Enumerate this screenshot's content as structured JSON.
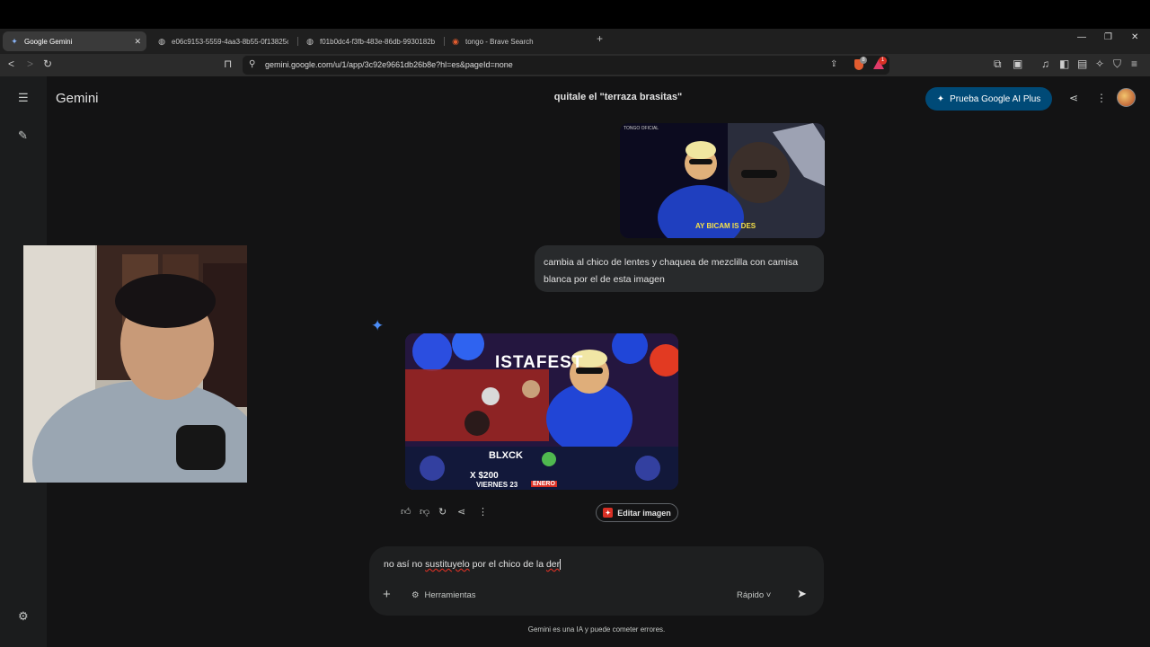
{
  "browser": {
    "tabs": [
      {
        "title": "Google Gemini",
        "active": true,
        "icon": "gemini-icon"
      },
      {
        "title": "e06c9153-5559-4aa3-8b55-0f13825c",
        "active": false,
        "icon": "globe-icon"
      },
      {
        "title": "f01b0dc4-f3fb-483e-86db-9930182b",
        "active": false,
        "icon": "globe-icon"
      },
      {
        "title": "tongo - Brave Search",
        "active": false,
        "icon": "brave-search-icon"
      }
    ],
    "url": "gemini.google.com/u/1/app/3c92e9661db26b8e?hl=es&pageId=none",
    "shield_badge": "8",
    "rewards_badge": "1"
  },
  "app": {
    "brand": "Gemini",
    "chat_title": "quitale el \"terraza brasitas\"",
    "upgrade_label": "Prueba Google AI Plus",
    "accent": "#004a77"
  },
  "conversation": {
    "user_image_caption": "AY BICAM IS DES",
    "user_image_watermark": "TONGO OFICIAL",
    "user_message": "cambia al chico de lentes y chaquea de mezclilla con camisa blanca por el de esta imagen",
    "generated_image_texts": {
      "fest": "ISTAFEST",
      "act": "BLXCK",
      "price1": "X $200",
      "date": "VIERNES 23",
      "month": "ENERO"
    },
    "edit_button_label": "Editar imagen"
  },
  "composer": {
    "text_before": "no así no ",
    "text_misspelled1": "sustituyelo",
    "text_middle": " por el chico de la ",
    "text_misspelled2": "der",
    "tools_label": "Herramientas",
    "mode_label": "Rápido"
  },
  "disclaimer": "Gemini es una IA y puede cometer errores."
}
